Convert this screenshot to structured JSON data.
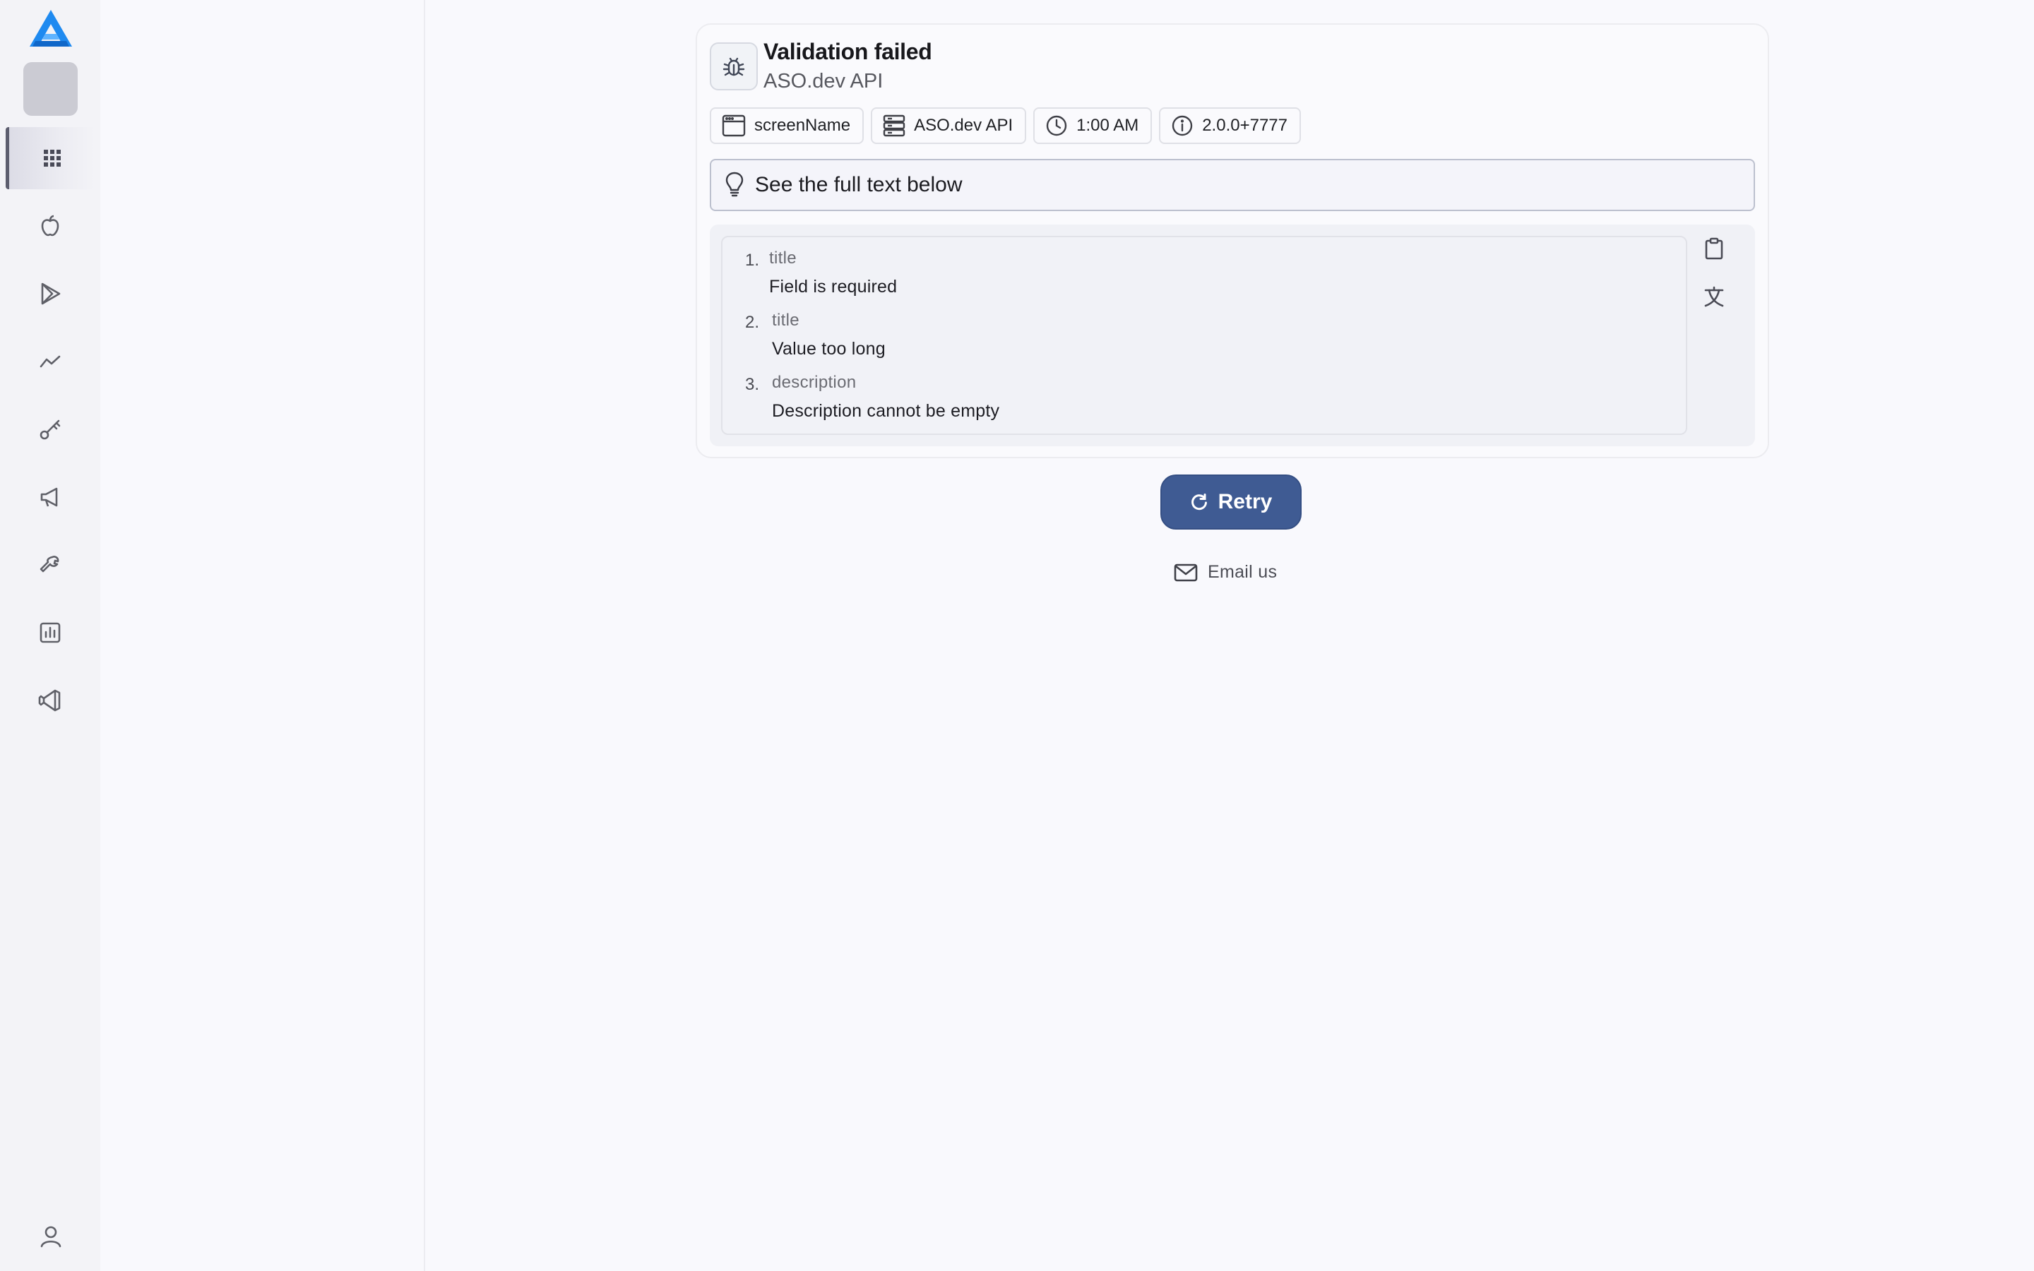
{
  "sidebar": {
    "logo_icon": "aso-dev-logo-icon",
    "items": [
      {
        "icon": "apps-grid-icon",
        "active": true
      },
      {
        "icon": "apple-icon",
        "active": false
      },
      {
        "icon": "google-play-icon",
        "active": false
      },
      {
        "icon": "trend-chart-icon",
        "active": false
      },
      {
        "icon": "key-icon",
        "active": false
      },
      {
        "icon": "megaphone-icon",
        "active": false
      },
      {
        "icon": "tools-icon",
        "active": false
      },
      {
        "icon": "bar-chart-icon",
        "active": false
      },
      {
        "icon": "vscode-icon",
        "active": false
      }
    ],
    "user_icon": "user-icon"
  },
  "error": {
    "title": "Validation failed",
    "subtitle": "ASO.dev API",
    "chips": {
      "screen": "screenName",
      "source": "ASO.dev API",
      "time": "1:00 AM",
      "version": "2.0.0+7777"
    },
    "hint": "See the full text below",
    "items": [
      {
        "num": "1.",
        "field": "title",
        "message": "Field is required"
      },
      {
        "num": "2.",
        "field": "title",
        "message": "Value too long"
      },
      {
        "num": "3.",
        "field": "description",
        "message": "Description cannot be empty"
      }
    ]
  },
  "actions": {
    "retry_label": "Retry",
    "email_label": "Email us"
  },
  "colors": {
    "accent": "#3f5b93",
    "logo_blue": "#1f8af0",
    "background": "#f9f9fd"
  }
}
